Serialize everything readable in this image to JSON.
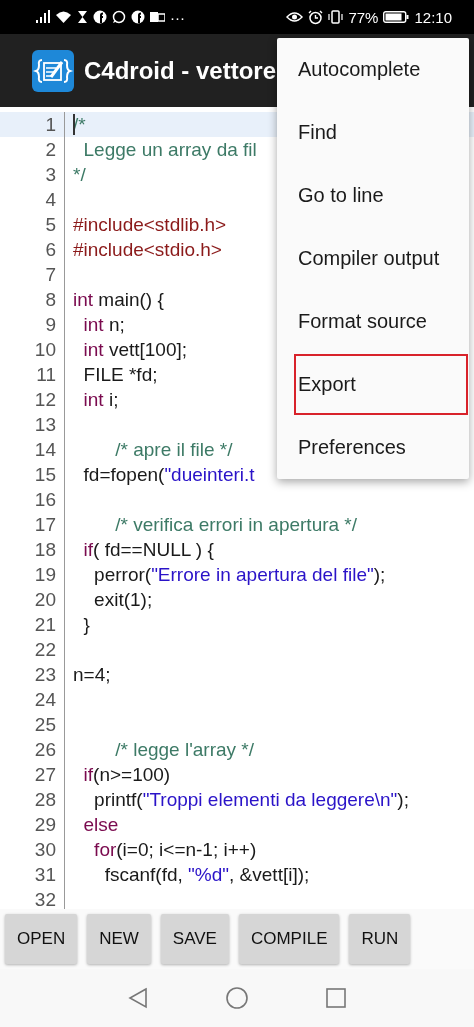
{
  "status_bar": {
    "more": "···",
    "battery": "77%",
    "time": "12:10"
  },
  "app_bar": {
    "title": "C4droid - vettore"
  },
  "editor": {
    "lines": [
      {
        "number": "1",
        "selected": true,
        "tokens": [
          {
            "kind": "comment",
            "text": "/*"
          }
        ]
      },
      {
        "number": "2",
        "selected": false,
        "tokens": [
          {
            "kind": "comment",
            "text": "  Legge un array da fil"
          }
        ]
      },
      {
        "number": "3",
        "selected": false,
        "tokens": [
          {
            "kind": "comment",
            "text": "*/"
          }
        ]
      },
      {
        "number": "4",
        "selected": false
      },
      {
        "number": "5",
        "selected": false,
        "tokens": [
          {
            "kind": "preprocessor",
            "text": "#include<stdlib.h>"
          }
        ]
      },
      {
        "number": "6",
        "selected": false,
        "tokens": [
          {
            "kind": "preprocessor",
            "text": "#include<stdio.h>"
          }
        ]
      },
      {
        "number": "7",
        "selected": false
      },
      {
        "number": "8",
        "selected": false,
        "tokens": [
          {
            "kind": "keyword",
            "text": "int"
          },
          {
            "kind": "plain",
            "text": " main() {"
          }
        ]
      },
      {
        "number": "9",
        "selected": false,
        "tokens": [
          {
            "kind": "keyword",
            "text": "  int"
          },
          {
            "kind": "plain",
            "text": " n;"
          }
        ]
      },
      {
        "number": "10",
        "selected": false,
        "tokens": [
          {
            "kind": "keyword",
            "text": "  int"
          },
          {
            "kind": "plain",
            "text": " vett[100];"
          }
        ]
      },
      {
        "number": "11",
        "selected": false,
        "tokens": [
          {
            "kind": "plain",
            "text": "  FILE *fd;"
          }
        ]
      },
      {
        "number": "12",
        "selected": false,
        "tokens": [
          {
            "kind": "keyword",
            "text": "  int"
          },
          {
            "kind": "plain",
            "text": " i;"
          }
        ]
      },
      {
        "number": "13",
        "selected": false
      },
      {
        "number": "14",
        "selected": false,
        "tokens": [
          {
            "kind": "comment",
            "text": "        /* apre il file */"
          }
        ]
      },
      {
        "number": "15",
        "selected": false,
        "tokens": [
          {
            "kind": "plain",
            "text": "  fd=fopen("
          },
          {
            "kind": "string",
            "text": "\"dueinteri.t"
          }
        ]
      },
      {
        "number": "16",
        "selected": false
      },
      {
        "number": "17",
        "selected": false,
        "tokens": [
          {
            "kind": "comment",
            "text": "        /* verifica errori in apertura */"
          }
        ]
      },
      {
        "number": "18",
        "selected": false,
        "tokens": [
          {
            "kind": "keyword",
            "text": "  if"
          },
          {
            "kind": "plain",
            "text": "( fd==NULL ) {"
          }
        ]
      },
      {
        "number": "19",
        "selected": false,
        "tokens": [
          {
            "kind": "plain",
            "text": "    perror("
          },
          {
            "kind": "string",
            "text": "\"Errore in apertura del file\""
          },
          {
            "kind": "plain",
            "text": ");"
          }
        ]
      },
      {
        "number": "20",
        "selected": false,
        "tokens": [
          {
            "kind": "plain",
            "text": "    exit(1);"
          }
        ]
      },
      {
        "number": "21",
        "selected": false,
        "tokens": [
          {
            "kind": "plain",
            "text": "  }"
          }
        ]
      },
      {
        "number": "22",
        "selected": false
      },
      {
        "number": "23",
        "selected": false,
        "tokens": [
          {
            "kind": "plain",
            "text": "n=4;"
          }
        ]
      },
      {
        "number": "24",
        "selected": false
      },
      {
        "number": "25",
        "selected": false
      },
      {
        "number": "26",
        "selected": false,
        "tokens": [
          {
            "kind": "comment",
            "text": "        /* legge l'array */"
          }
        ]
      },
      {
        "number": "27",
        "selected": false,
        "tokens": [
          {
            "kind": "keyword",
            "text": "  if"
          },
          {
            "kind": "plain",
            "text": "(n>=100)"
          }
        ]
      },
      {
        "number": "28",
        "selected": false,
        "tokens": [
          {
            "kind": "plain",
            "text": "    printf("
          },
          {
            "kind": "string",
            "text": "\"Troppi elementi da leggere\\n\""
          },
          {
            "kind": "plain",
            "text": ");"
          }
        ]
      },
      {
        "number": "29",
        "selected": false,
        "tokens": [
          {
            "kind": "keyword",
            "text": "  else"
          }
        ]
      },
      {
        "number": "30",
        "selected": false,
        "tokens": [
          {
            "kind": "keyword",
            "text": "    for"
          },
          {
            "kind": "plain",
            "text": "(i=0; i<=n-1; i++)"
          }
        ]
      },
      {
        "number": "31",
        "selected": false,
        "tokens": [
          {
            "kind": "plain",
            "text": "      fscanf(fd, "
          },
          {
            "kind": "string",
            "text": "\"%d\""
          },
          {
            "kind": "plain",
            "text": ", &vett[i]);"
          }
        ]
      },
      {
        "number": "32",
        "selected": false
      }
    ]
  },
  "menu": {
    "items": [
      {
        "label": "Autocomplete",
        "highlighted": false
      },
      {
        "label": "Find",
        "highlighted": false
      },
      {
        "label": "Go to line",
        "highlighted": false
      },
      {
        "label": "Compiler output",
        "highlighted": false
      },
      {
        "label": "Format source",
        "highlighted": false
      },
      {
        "label": "Export",
        "highlighted": true
      },
      {
        "label": "Preferences",
        "highlighted": false
      }
    ]
  },
  "toolbar": {
    "buttons": [
      "OPEN",
      "NEW",
      "SAVE",
      "COMPILE",
      "RUN"
    ]
  }
}
